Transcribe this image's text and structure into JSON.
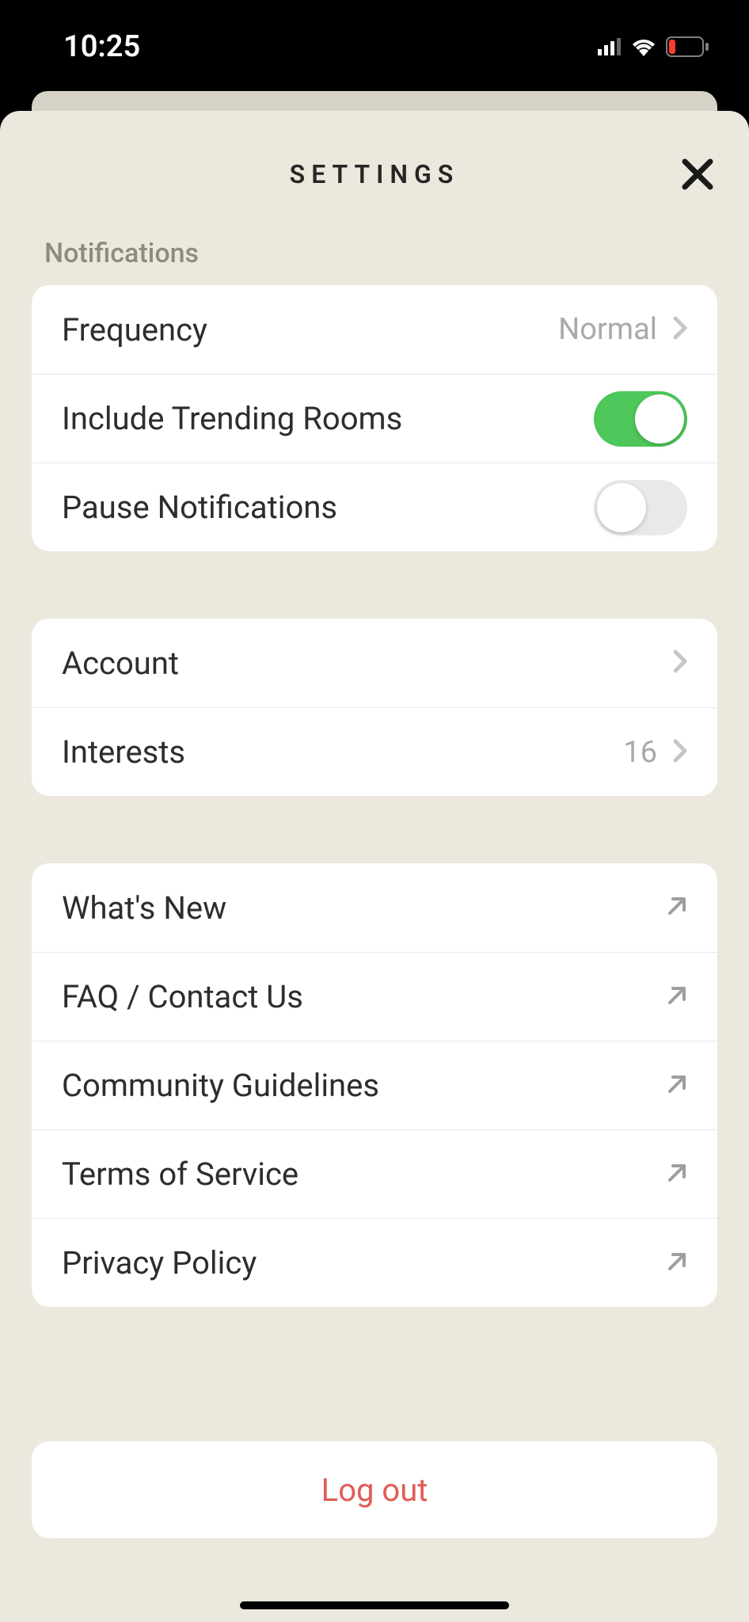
{
  "status": {
    "time": "10:25"
  },
  "header": {
    "title": "SETTINGS"
  },
  "sections": {
    "notifications": {
      "header": "Notifications",
      "frequency": {
        "label": "Frequency",
        "value": "Normal"
      },
      "trending": {
        "label": "Include Trending Rooms",
        "on": true
      },
      "pause": {
        "label": "Pause Notifications",
        "on": false
      }
    },
    "account_group": {
      "account": {
        "label": "Account"
      },
      "interests": {
        "label": "Interests",
        "value": "16"
      }
    },
    "links": {
      "whatsnew": {
        "label": "What's New"
      },
      "faq": {
        "label": "FAQ / Contact Us"
      },
      "guidelines": {
        "label": "Community Guidelines"
      },
      "tos": {
        "label": "Terms of Service"
      },
      "privacy": {
        "label": "Privacy Policy"
      }
    },
    "logout": {
      "label": "Log out"
    }
  }
}
